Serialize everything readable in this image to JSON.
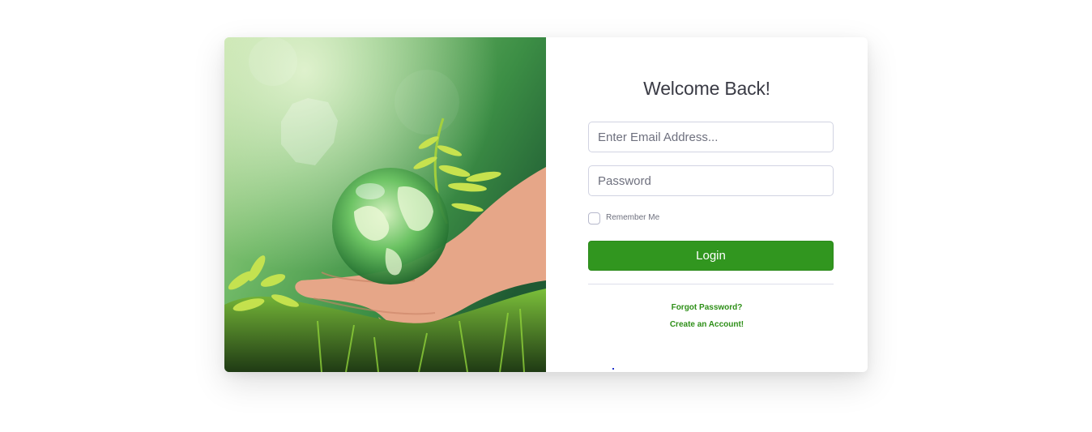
{
  "login": {
    "title": "Welcome Back!",
    "email_placeholder": "Enter Email Address...",
    "password_placeholder": "Password",
    "remember_label": "Remember Me",
    "login_label": "Login",
    "forgot_label": "Forgot Password?",
    "create_label": "Create an Account!"
  },
  "image": {
    "subject": "hands-holding-glass-globe-with-fern",
    "colors": {
      "forest_green": "#3f8f3a",
      "light_green": "#9ed36a",
      "moss": "#3e6b1f",
      "skin": "#e8a98a"
    }
  },
  "colors": {
    "accent": "#31961f",
    "link": "#2e8f18",
    "title": "#3a3b45",
    "border": "#d1d3e2"
  }
}
